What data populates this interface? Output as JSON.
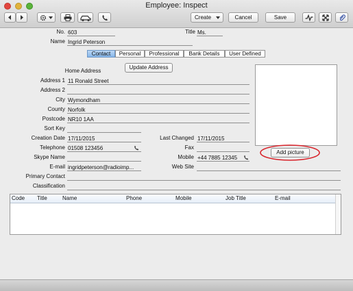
{
  "window": {
    "title": "Employee: Inspect"
  },
  "toolbar": {
    "create_label": "Create",
    "cancel_label": "Cancel",
    "save_label": "Save"
  },
  "form": {
    "no_label": "No.",
    "no_value": "603",
    "title_label": "Title",
    "title_value": "Ms.",
    "name_label": "Name",
    "name_value": "Ingrid Peterson"
  },
  "tabs": [
    "Contact",
    "Personal",
    "Professional",
    "Bank Details",
    "User Defined"
  ],
  "contact": {
    "home_address_label": "Home Address",
    "update_address_button": "Update Address",
    "address1_label": "Address 1",
    "address1_value": "11 Ronald Street",
    "address2_label": "Address 2",
    "address2_value": "",
    "city_label": "City",
    "city_value": "Wymondham",
    "county_label": "County",
    "county_value": "Norfolk",
    "postcode_label": "Postcode",
    "postcode_value": "NR10 1AA",
    "sortkey_label": "Sort Key",
    "sortkey_value": "",
    "creation_date_label": "Creation Date",
    "creation_date_value": "17/11/2015",
    "last_changed_label": "Last Changed",
    "last_changed_value": "17/11/2015",
    "telephone_label": "Telephone",
    "telephone_value": "01508 123456",
    "fax_label": "Fax",
    "fax_value": "",
    "skype_label": "Skype Name",
    "skype_value": "",
    "mobile_label": "Mobile",
    "mobile_value": "+44 7885 12345",
    "email_label": "E-mail",
    "email_value": "ingridpeterson@radioimp...",
    "website_label": "Web Site",
    "website_value": "",
    "primary_contact_label": "Primary Contact",
    "primary_contact_value": "",
    "classification_label": "Classification",
    "classification_value": "",
    "add_picture_button": "Add picture"
  },
  "grid": {
    "columns": [
      "Code",
      "Title",
      "Name",
      "Phone",
      "Mobile",
      "Job Title",
      "E-mail"
    ]
  },
  "icons": [
    "back-arrow-icon",
    "forward-arrow-icon",
    "gear-icon",
    "print-icon",
    "car-icon",
    "phone-icon",
    "activity-icon",
    "fullscreen-icon",
    "attachment-icon"
  ],
  "colors": {
    "active_tab": "#8bb9ea",
    "highlight_circle": "#d8242b",
    "title_bar": "#dcdcdc"
  }
}
